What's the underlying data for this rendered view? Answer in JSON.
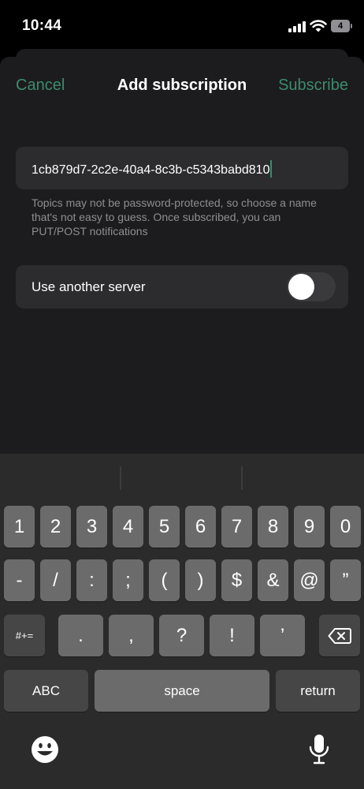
{
  "status": {
    "time": "10:44",
    "battery": "4"
  },
  "nav": {
    "cancel": "Cancel",
    "title": "Add subscription",
    "subscribe": "Subscribe"
  },
  "form": {
    "topic_value": "1cb879d7-2c2e-40a4-8c3b-c5343babd810",
    "hint": "Topics may not be password-protected, so choose a name that's not easy to guess. Once subscribed, you can PUT/POST notifications",
    "server_label": "Use another server",
    "server_toggle_on": false
  },
  "keyboard": {
    "row1": [
      "1",
      "2",
      "3",
      "4",
      "5",
      "6",
      "7",
      "8",
      "9",
      "0"
    ],
    "row2": [
      "-",
      "/",
      ":",
      ";",
      "(",
      ")",
      "$",
      "&",
      "@",
      "”"
    ],
    "row3": [
      ".",
      ",",
      "?",
      "!",
      "’"
    ],
    "symbols_key": "#+=",
    "abc_key": "ABC",
    "space_key": "space",
    "return_key": "return"
  },
  "icons": [
    "signal-icon",
    "wifi-icon",
    "battery-icon",
    "delete-icon",
    "emoji-icon",
    "microphone-icon"
  ],
  "colors": {
    "accent": "#3d8b6c",
    "sheet": "#1c1c1e",
    "field": "#2c2c2e",
    "key": "#6b6b6b",
    "key_dark": "#464646"
  }
}
